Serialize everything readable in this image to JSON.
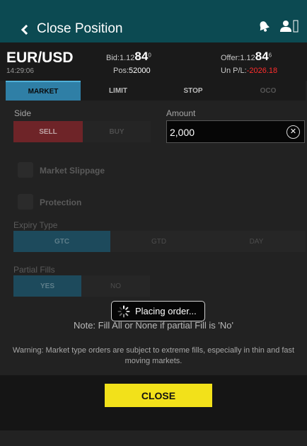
{
  "header": {
    "title": "Close Position",
    "icons": [
      "back-chevron-icon",
      "notification-icon",
      "user-icon"
    ]
  },
  "quote": {
    "pair": "EUR/USD",
    "time": "14:29:06",
    "bid": {
      "label": "Bid:",
      "prefix": "1.12",
      "big": "84",
      "sup": "0"
    },
    "offer": {
      "label": "Offer:",
      "prefix": "1.12",
      "big": "84",
      "sup": "6"
    },
    "pos": {
      "label": "Pos:",
      "value": "52000"
    },
    "upl": {
      "label": "Un P/L:",
      "value": "-2026.18"
    }
  },
  "tabs": [
    "MARKET",
    "LIMIT",
    "STOP",
    "OCO"
  ],
  "form": {
    "side_label": "Side",
    "sell_label": "SELL",
    "buy_label": "BUY",
    "amount_label": "Amount",
    "amount_value": "2,000",
    "market_slippage_label": "Market Slippage",
    "protection_label": "Protection",
    "expiry_label": "Expiry Type",
    "expiry_options": [
      "GTC",
      "GTD",
      "DAY"
    ],
    "partial_fills_label": "Partial Fills",
    "partial_options": [
      "YES",
      "NO"
    ]
  },
  "note": "Note: Fill All or None if partial Fill is 'No'",
  "warning": "Warning: Market type orders are subject to extreme fills, especially in thin and fast moving markets.",
  "close_label": "CLOSE",
  "toast": "Placing order...",
  "colors": {
    "header_bg": "#0c4a52",
    "active_tab": "#2f7fa6",
    "sell": "#6e2428",
    "close_button": "#f2e11a",
    "negative": "#ff2d2d"
  }
}
